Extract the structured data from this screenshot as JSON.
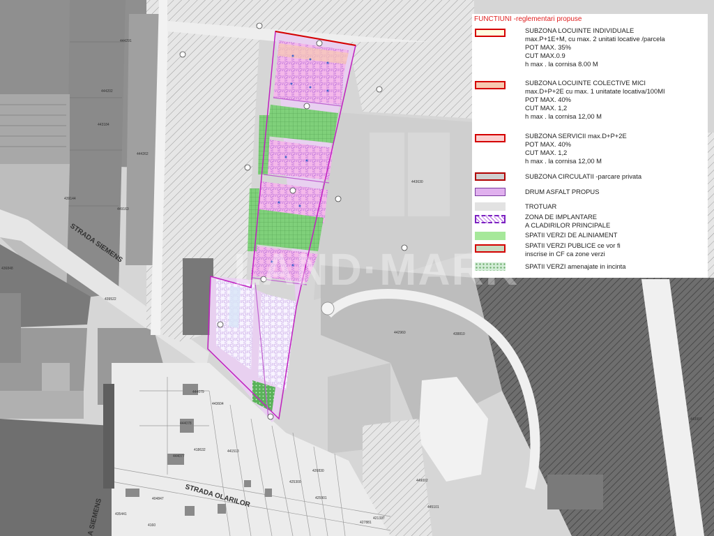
{
  "map": {
    "watermark": "LAND·MARK",
    "streets": {
      "siemens_upper": "STRADA SIEMENS",
      "siemens_lower": "A SIEMENS",
      "olarilor": "STRADA OLARILOR"
    },
    "parcel_ids": [
      "444291",
      "444202",
      "443184",
      "444262",
      "439144",
      "449163",
      "439522",
      "436848",
      "444079",
      "443604",
      "444078",
      "441513",
      "444077",
      "418632",
      "426830",
      "425300",
      "442960",
      "425901",
      "427881",
      "421337",
      "4160",
      "435441",
      "445101",
      "443630",
      "449002",
      "443907",
      "438810",
      "404847"
    ]
  },
  "legend": {
    "title": "FUNCTIUNI -reglementari propuse",
    "items": [
      {
        "key": "subzona-locuinte-individuale",
        "lines": [
          "SUBZONA  LOCUINTE INDIVIDUALE",
          "max.P+1E+M, cu max. 2 unitati locative /parcela",
          "POT MAX.  35%",
          "CUT MAX.0.9",
          "h max . la cornisa 8.00 M"
        ]
      },
      {
        "key": "subzona-locuinte-colective-mici",
        "lines": [
          "SUBZONA  LOCUINTE COLECTIVE MICI",
          "max.D+P+2E cu max. 1 unitatate locativa/100MI",
          "POT MAX. 40%",
          "CUT MAX. 1,2",
          "h max . la cornisa 12,00 M"
        ]
      },
      {
        "key": "subzona-servicii",
        "lines": [
          "SUBZONA SERVICII  max.D+P+2E",
          "POT MAX. 40%",
          "CUT MAX. 1,2",
          "h max . la cornisa 12,00 M"
        ]
      },
      {
        "key": "subzona-circulatii",
        "lines": [
          "SUBZONA  CIRCULATII -parcare privata"
        ]
      },
      {
        "key": "drum-asfalt-propus",
        "lines": [
          "DRUM  ASFALT  PROPUS"
        ]
      },
      {
        "key": "trotuar",
        "lines": [
          "TROTUAR"
        ]
      },
      {
        "key": "zona-de-implantare",
        "lines": [
          "ZONA DE IMPLANTARE",
          "A CLADIRILOR PRINCIPALE"
        ]
      },
      {
        "key": "spatii-verzi-de-aliniament",
        "lines": [
          "SPATII VERZI  DE ALINIAMENT"
        ]
      },
      {
        "key": "spatii-verzi-publice",
        "lines": [
          "SPATII VERZI PUBLICE  ce vor fi",
          "inscrise in CF ca zone verzi"
        ]
      },
      {
        "key": "spatii-verzi-amenajate",
        "lines": [
          "SPATII VERZI amenajate in incinta"
        ]
      }
    ]
  }
}
